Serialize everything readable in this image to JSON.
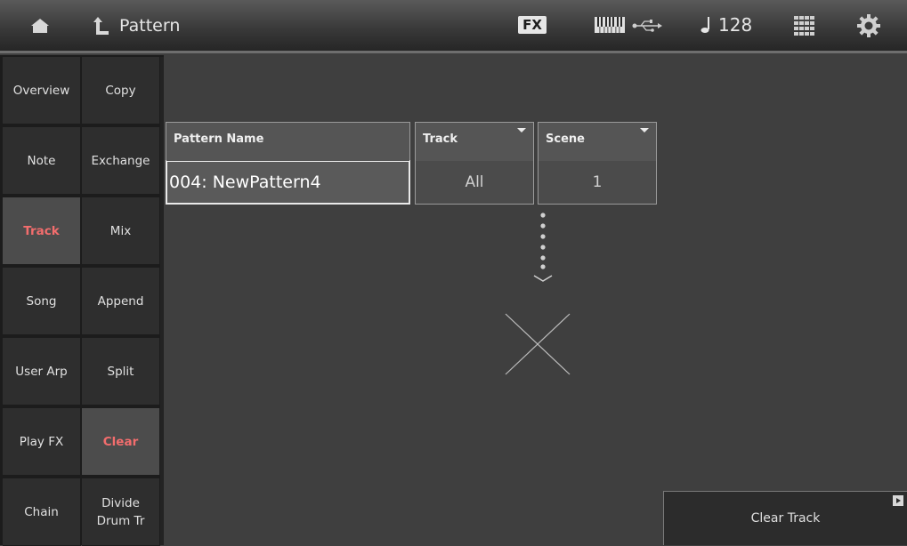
{
  "header": {
    "title": "Pattern",
    "fx_label": "FX",
    "tempo": "128",
    "icons": [
      "home-icon",
      "back-arrow-icon",
      "keyboard-icon",
      "usb-icon",
      "note-icon",
      "grid-icon",
      "gear-icon"
    ]
  },
  "left_nav": {
    "col1": [
      "Overview",
      "Note",
      "Track",
      "Song",
      "User Arp",
      "Play FX",
      "Chain"
    ],
    "col2": [
      "Copy",
      "Exchange",
      "Mix",
      "Append",
      "Split",
      "Clear",
      "Divide\nDrum Tr"
    ],
    "selected_col1": "Track",
    "selected_col2": "Clear"
  },
  "params": {
    "pattern_name": {
      "label": "Pattern Name",
      "value": "004: NewPattern4"
    },
    "track": {
      "label": "Track",
      "value": "All"
    },
    "scene": {
      "label": "Scene",
      "value": "1"
    }
  },
  "actions": {
    "clear_track": "Clear Track"
  },
  "colors": {
    "selected_text": "#f26d6d",
    "background": "#3f3f3f"
  }
}
